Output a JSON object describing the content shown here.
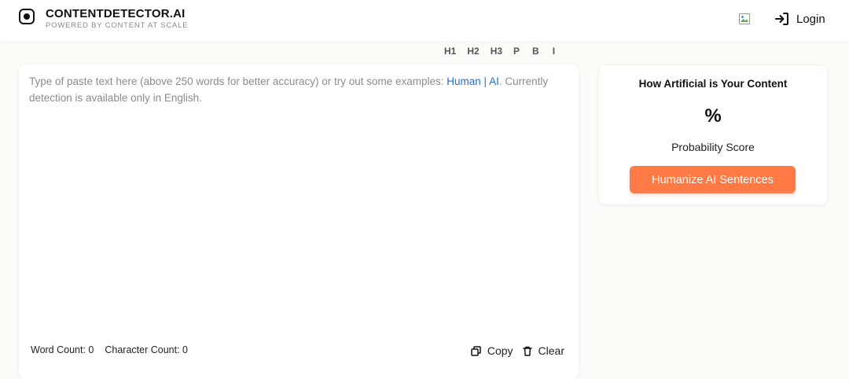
{
  "header": {
    "brand_name": "CONTENTDETECTOR.AI",
    "brand_tagline": "POWERED BY CONTENT AT SCALE",
    "login_label": "Login",
    "broken_image_icon": "broken-image-icon",
    "login_icon": "login-arrow-icon"
  },
  "format_toolbar": {
    "h1": "H1",
    "h2": "H2",
    "h3": "H3",
    "p": "P",
    "b": "B",
    "i": "I"
  },
  "editor": {
    "placeholder_before": "Type of paste text here (above 250 words for better accuracy) or try out some examples: ",
    "example_human": "Human",
    "separator": " | ",
    "example_ai": "AI",
    "placeholder_after": ". Currently detection is available only in English.",
    "word_count_label": "Word Count: 0",
    "char_count_label": "Character Count: 0",
    "copy_label": "Copy",
    "clear_label": "Clear",
    "copy_icon": "copy-icon",
    "clear_icon": "trash-icon"
  },
  "score_card": {
    "title": "How Artificial is Your Content",
    "value": "%",
    "label": "Probability Score",
    "button_label": "Humanize AI Sentences"
  },
  "colors": {
    "accent": "#ff7a45",
    "link": "#1f6fd1",
    "background": "#fdfbf8"
  }
}
